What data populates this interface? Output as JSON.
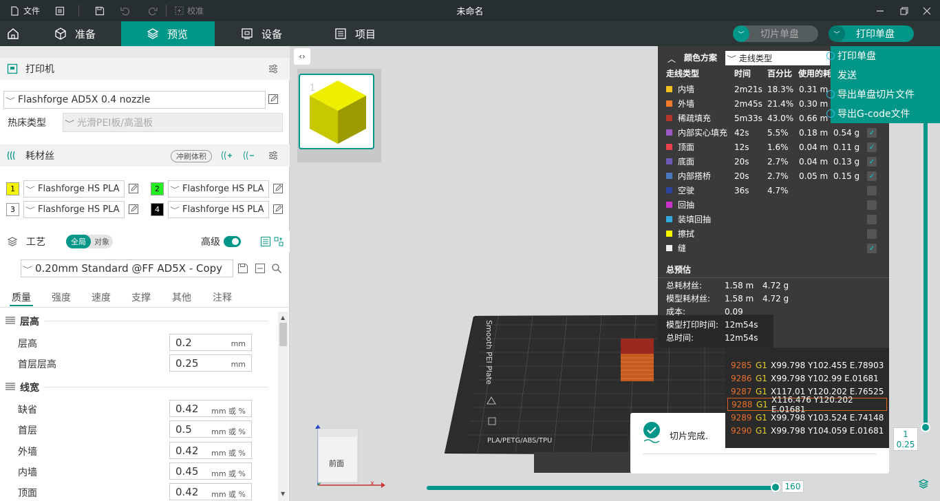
{
  "window": {
    "title": "未命名",
    "menu_file": "文件",
    "calibrate": "校准"
  },
  "nav": {
    "tabs": [
      "准备",
      "预览",
      "设备",
      "项目"
    ],
    "active": "预览",
    "slice_btn": "切片单盘",
    "print_btn": "打印单盘"
  },
  "printer": {
    "section": "打印机",
    "preset": "Flashforge AD5X 0.4 nozzle",
    "bed_label": "热床类型",
    "bed_value": "光滑PEI板/高温板"
  },
  "filament": {
    "section": "耗材丝",
    "flush_btn": "冲刷体积",
    "slots": [
      {
        "num": "1",
        "name": "Flashforge HS PLA",
        "color": "#f6f600"
      },
      {
        "num": "2",
        "name": "Flashforge HS PLA",
        "color": "#22ee22"
      },
      {
        "num": "3",
        "name": "Flashforge HS PLA",
        "color": "#ffffff"
      },
      {
        "num": "4",
        "name": "Flashforge HS PLA",
        "color": "#000000"
      }
    ]
  },
  "process": {
    "section": "工艺",
    "toggle_global": "全局",
    "toggle_object": "对象",
    "advanced": "高级",
    "preset": "0.20mm Standard @FF AD5X - Copy",
    "tabs": [
      "质量",
      "强度",
      "速度",
      "支撑",
      "其他",
      "注释"
    ],
    "active_tab": "质量",
    "groups": [
      {
        "title": "层高",
        "items": [
          {
            "label": "层高",
            "value": "0.2",
            "unit": "mm"
          },
          {
            "label": "首层层高",
            "value": "0.25",
            "unit": "mm"
          }
        ]
      },
      {
        "title": "线宽",
        "items": [
          {
            "label": "缺省",
            "value": "0.42",
            "unit": "mm 或 %"
          },
          {
            "label": "首层",
            "value": "0.5",
            "unit": "mm 或 %"
          },
          {
            "label": "外墙",
            "value": "0.42",
            "unit": "mm 或 %"
          },
          {
            "label": "内墙",
            "value": "0.45",
            "unit": "mm 或 %"
          },
          {
            "label": "顶面",
            "value": "0.42",
            "unit": "mm 或 %"
          }
        ]
      }
    ]
  },
  "plate": {
    "number": "1",
    "bed_text": "Smooth PEI Plate",
    "bed_bottom": "PLA/PETG/ABS/TPU"
  },
  "view_cube": {
    "label": "前面",
    "axis_x": "x"
  },
  "legend": {
    "title": "颜色方案",
    "scheme": "走线类型",
    "headers": [
      "走线类型",
      "时间",
      "百分比",
      "使用的耗"
    ],
    "rows": [
      {
        "name": "内墙",
        "time": "2m21s",
        "pct": "18.3%",
        "len": "0.31 m",
        "wt": "",
        "color": "#f3c11f",
        "checked": true
      },
      {
        "name": "外墙",
        "time": "2m45s",
        "pct": "21.4%",
        "len": "0.30 m",
        "wt": "",
        "color": "#ef7b2b",
        "checked": true
      },
      {
        "name": "稀疏填充",
        "time": "5m33s",
        "pct": "43.0%",
        "len": "0.66 m",
        "wt": "",
        "color": "#b4362a",
        "checked": true
      },
      {
        "name": "内部实心填充",
        "time": "42s",
        "pct": "5.5%",
        "len": "0.18 m",
        "wt": "0.54 g",
        "color": "#9b57c4",
        "checked": true
      },
      {
        "name": "顶面",
        "time": "12s",
        "pct": "1.6%",
        "len": "0.04 m",
        "wt": "0.11 g",
        "color": "#e8404a",
        "checked": true
      },
      {
        "name": "底面",
        "time": "20s",
        "pct": "2.7%",
        "len": "0.04 m",
        "wt": "0.13 g",
        "color": "#6d5ab8",
        "checked": true
      },
      {
        "name": "内部搭桥",
        "time": "20s",
        "pct": "2.7%",
        "len": "0.05 m",
        "wt": "0.15 g",
        "color": "#4a79c0",
        "checked": true
      },
      {
        "name": "空驶",
        "time": "36s",
        "pct": "4.7%",
        "len": "",
        "wt": "",
        "color": "#2a44a0",
        "checked": false
      },
      {
        "name": "回抽",
        "time": "",
        "pct": "",
        "len": "",
        "wt": "",
        "color": "#cc33cc",
        "checked": false
      },
      {
        "name": "装填回抽",
        "time": "",
        "pct": "",
        "len": "",
        "wt": "",
        "color": "#33aadd",
        "checked": false
      },
      {
        "name": "擦拭",
        "time": "",
        "pct": "",
        "len": "",
        "wt": "",
        "color": "#f6f600",
        "checked": false
      },
      {
        "name": "缝",
        "time": "",
        "pct": "",
        "len": "",
        "wt": "",
        "color": "#eeeeee",
        "checked": true
      }
    ],
    "summary_title": "总预估",
    "summary": [
      {
        "label": "总耗材丝:",
        "v1": "1.58 m",
        "v2": "4.72 g"
      },
      {
        "label": "模型耗材丝:",
        "v1": "1.58 m",
        "v2": "4.72 g"
      },
      {
        "label": "成本:",
        "v1": "0.09",
        "v2": ""
      },
      {
        "label": "模型打印时间:",
        "v1": "12m54s",
        "v2": ""
      },
      {
        "label": "总时间:",
        "v1": "12m54s",
        "v2": ""
      }
    ]
  },
  "gcode": [
    {
      "line": "9285",
      "cmd": "G1",
      "args": "X99.798 Y102.455 E.78903",
      "current": false
    },
    {
      "line": "9286",
      "cmd": "G1",
      "args": "X99.798 Y102.99 E.01681",
      "current": false
    },
    {
      "line": "9287",
      "cmd": "G1",
      "args": "X117.01 Y120.202 E.76525",
      "current": false
    },
    {
      "line": "9288",
      "cmd": "G1",
      "args": "X116.476 Y120.202 E.01681",
      "current": true
    },
    {
      "line": "9289",
      "cmd": "G1",
      "args": "X99.798 Y103.524 E.74148",
      "current": false
    },
    {
      "line": "9290",
      "cmd": "G1",
      "args": "X99.798 Y104.059 E.01681",
      "current": false
    }
  ],
  "dropdown": {
    "items": [
      "打印单盘",
      "发送",
      "导出单盘切片文件",
      "导出G-code文件"
    ]
  },
  "notification": {
    "text": "切片完成."
  },
  "sliders": {
    "horizontal_value": "160",
    "vertical_top": "1",
    "vertical_bottom": "0.25"
  },
  "colors": {
    "accent": "#009688",
    "titlebar": "#262e30",
    "navbar": "#2d3537"
  }
}
